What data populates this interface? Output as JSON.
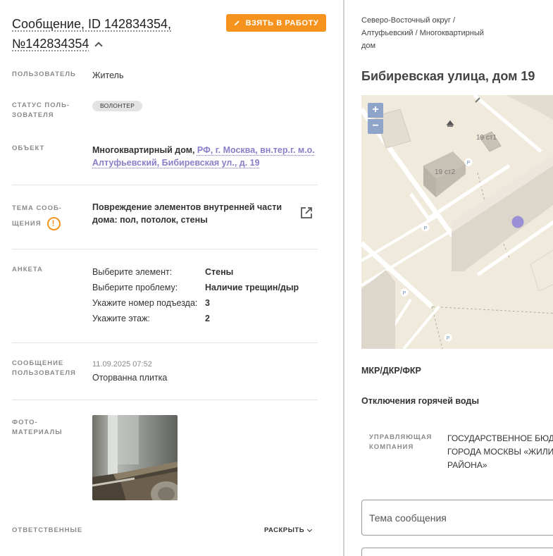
{
  "message": {
    "title_line1": "Сообщение, ID 142834354,",
    "title_line2": "№142834354",
    "take_button": "ВЗЯТЬ В РАБОТУ"
  },
  "details": {
    "user_label": "ПОЛЬЗОВАТЕЛЬ",
    "user_value": "Житель",
    "user_status_label_1": "СТАТУС ПОЛЬ-",
    "user_status_label_2": "ЗОВАТЕЛЯ",
    "user_status_value": "ВОЛОНТЕР",
    "object_label": "ОБЪЕКТ",
    "object_type": "Многоквартирный дом, ",
    "object_address_line1": "РФ, г. Москва, вн.тер.г. м.о.",
    "object_address_line2": "Алтуфьевский, Бибиревская ул., д. 19",
    "topic_label_1": "ТЕМА СООБ-",
    "topic_label_2": "ЩЕНИЯ",
    "topic_value_line1": "Повреждение элементов внутренней части",
    "topic_value_line2": "дома: пол, потолок, стены",
    "survey_label": "АНКЕТА",
    "survey": [
      {
        "q": "Выберите элемент:",
        "a": "Стены"
      },
      {
        "q": "Выберите проблему:",
        "a": "Наличие трещин/дыр"
      },
      {
        "q": "Укажите номер подъезда:",
        "a": "3"
      },
      {
        "q": "Укажите этаж:",
        "a": "2"
      }
    ],
    "user_message_label_1": "СООБЩЕНИЕ",
    "user_message_label_2": "ПОЛЬЗОВАТЕЛЯ",
    "user_message_date": "11.09.2025 07:52",
    "user_message_text": "Оторванна плитка",
    "photo_label_1": "ФОТО-",
    "photo_label_2": "МАТЕРИАЛЫ",
    "responsible_label": "ОТВЕТСТВЕННЫЕ",
    "expand_label": "РАСКРЫТЬ"
  },
  "location": {
    "breadcrumb_line1": "Северо-Восточный округ /",
    "breadcrumb_line2": "Алтуфьевский / Многоквартирный",
    "breadcrumb_line3": "дом",
    "address": "Бибиревская улица, дом 19",
    "map": {
      "zoom_in": "+",
      "zoom_out": "−",
      "building_1": "19 ст1",
      "building_2": "19 ст2",
      "parking": "P"
    },
    "district_type": "МКР/ДКР/ФКР",
    "hot_water": "Отключения горячей воды",
    "mgmt_label_1": "УПРАВЛЯЮЩАЯ",
    "mgmt_label_2": "КОМПАНИЯ",
    "mgmt_value_line1": "ГОСУДАРСТВЕННОЕ БЮДЖ",
    "mgmt_value_line2": "ГОРОДА МОСКВЫ «ЖИЛИ",
    "mgmt_value_line3": "РАЙОНА»",
    "topic_placeholder": "Тема сообщения"
  },
  "colors": {
    "accent": "#f5931e",
    "link": "#8b7ec9",
    "map_marker": "#9b8fd6"
  }
}
